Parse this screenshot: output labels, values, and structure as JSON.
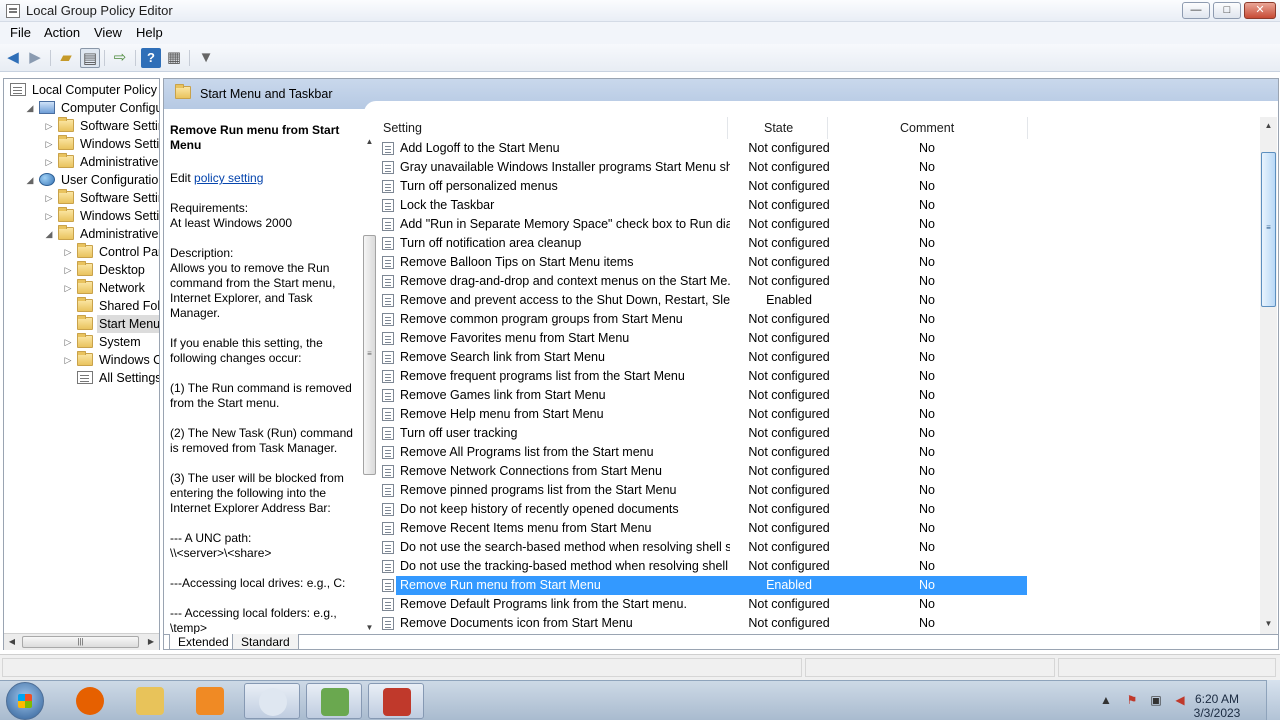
{
  "window": {
    "title": "Local Group Policy Editor",
    "min": "—",
    "max": "□",
    "close": "✕"
  },
  "menu": [
    "File",
    "Action",
    "View",
    "Help"
  ],
  "toolbar": [
    "back-icon",
    "forward-icon",
    "up-folder-icon",
    "show-hide-tree-icon",
    "export-list-icon",
    "help-icon",
    "properties-icon",
    "filter-icon"
  ],
  "tree": [
    {
      "label": "Local Computer Policy",
      "level": 0,
      "icon": "policy-doc-icon",
      "expander": ""
    },
    {
      "label": "Computer Configura",
      "level": 1,
      "icon": "computer-icon",
      "expander": "◢"
    },
    {
      "label": "Software Settings",
      "level": 2,
      "icon": "folder-icon",
      "expander": "▷"
    },
    {
      "label": "Windows Setting",
      "level": 2,
      "icon": "folder-icon",
      "expander": "▷"
    },
    {
      "label": "Administrative Te",
      "level": 2,
      "icon": "folder-icon",
      "expander": "▷"
    },
    {
      "label": "User Configuration",
      "level": 1,
      "icon": "users-icon",
      "expander": "◢"
    },
    {
      "label": "Software Settings",
      "level": 2,
      "icon": "folder-icon",
      "expander": "▷"
    },
    {
      "label": "Windows Setting",
      "level": 2,
      "icon": "folder-icon",
      "expander": "▷"
    },
    {
      "label": "Administrative Te",
      "level": 2,
      "icon": "folder-icon",
      "expander": "◢"
    },
    {
      "label": "Control Panel",
      "level": 3,
      "icon": "folder-icon",
      "expander": "▷"
    },
    {
      "label": "Desktop",
      "level": 3,
      "icon": "folder-icon",
      "expander": "▷"
    },
    {
      "label": "Network",
      "level": 3,
      "icon": "folder-icon",
      "expander": "▷"
    },
    {
      "label": "Shared Folder",
      "level": 3,
      "icon": "folder-icon",
      "expander": ""
    },
    {
      "label": "Start Menu ar",
      "level": 3,
      "icon": "folder-icon",
      "expander": "",
      "selected": true
    },
    {
      "label": "System",
      "level": 3,
      "icon": "folder-icon",
      "expander": "▷"
    },
    {
      "label": "Windows Cor",
      "level": 3,
      "icon": "folder-icon",
      "expander": "▷"
    },
    {
      "label": "All Settings",
      "level": 3,
      "icon": "all-settings-icon",
      "expander": ""
    }
  ],
  "pane": {
    "header": "Start Menu and Taskbar"
  },
  "description": {
    "title": "Remove Run menu from Start Menu",
    "edit_prefix": "Edit ",
    "edit_link": "policy setting",
    "paragraphs": [
      "Requirements:\nAt least Windows 2000",
      "Description:\nAllows you to remove the Run command from the Start menu, Internet Explorer, and Task Manager.",
      "If you enable this setting, the following changes occur:",
      "(1) The Run command is removed from the Start menu.",
      "(2) The New Task (Run) command is removed from Task Manager.",
      "(3) The user will be blocked from entering the following into the Internet Explorer Address Bar:",
      "--- A UNC path:\n\\\\<server>\\<share>",
      "---Accessing local drives:  e.g., C:",
      "--- Accessing local folders: e.g.,\n\\temp>"
    ]
  },
  "columns": {
    "setting": "Setting",
    "state": "State",
    "comment": "Comment"
  },
  "rows": [
    {
      "setting": "Add Logoff to the Start Menu",
      "state": "Not configured",
      "comment": "No"
    },
    {
      "setting": "Gray unavailable Windows Installer programs Start Menu sh...",
      "state": "Not configured",
      "comment": "No"
    },
    {
      "setting": "Turn off personalized menus",
      "state": "Not configured",
      "comment": "No"
    },
    {
      "setting": "Lock the Taskbar",
      "state": "Not configured",
      "comment": "No"
    },
    {
      "setting": "Add \"Run in Separate Memory Space\" check box to Run dial...",
      "state": "Not configured",
      "comment": "No"
    },
    {
      "setting": "Turn off notification area cleanup",
      "state": "Not configured",
      "comment": "No"
    },
    {
      "setting": "Remove Balloon Tips on Start Menu items",
      "state": "Not configured",
      "comment": "No"
    },
    {
      "setting": "Remove drag-and-drop and context menus on the Start Me...",
      "state": "Not configured",
      "comment": "No"
    },
    {
      "setting": "Remove and prevent access to the Shut Down, Restart, Sleep...",
      "state": "Enabled",
      "comment": "No"
    },
    {
      "setting": "Remove common program groups from Start Menu",
      "state": "Not configured",
      "comment": "No"
    },
    {
      "setting": "Remove Favorites menu from Start Menu",
      "state": "Not configured",
      "comment": "No"
    },
    {
      "setting": "Remove Search link from Start Menu",
      "state": "Not configured",
      "comment": "No"
    },
    {
      "setting": "Remove frequent programs list from the Start Menu",
      "state": "Not configured",
      "comment": "No"
    },
    {
      "setting": "Remove Games link from Start Menu",
      "state": "Not configured",
      "comment": "No"
    },
    {
      "setting": "Remove Help menu from Start Menu",
      "state": "Not configured",
      "comment": "No"
    },
    {
      "setting": "Turn off user tracking",
      "state": "Not configured",
      "comment": "No"
    },
    {
      "setting": "Remove All Programs list from the Start menu",
      "state": "Not configured",
      "comment": "No"
    },
    {
      "setting": "Remove Network Connections from Start Menu",
      "state": "Not configured",
      "comment": "No"
    },
    {
      "setting": "Remove pinned programs list from the Start Menu",
      "state": "Not configured",
      "comment": "No"
    },
    {
      "setting": "Do not keep history of recently opened documents",
      "state": "Not configured",
      "comment": "No"
    },
    {
      "setting": "Remove Recent Items menu from Start Menu",
      "state": "Not configured",
      "comment": "No"
    },
    {
      "setting": "Do not use the search-based method when resolving shell s...",
      "state": "Not configured",
      "comment": "No"
    },
    {
      "setting": "Do not use the tracking-based method when resolving shell ...",
      "state": "Not configured",
      "comment": "No"
    },
    {
      "setting": "Remove Run menu from Start Menu",
      "state": "Enabled",
      "comment": "No",
      "selected": true
    },
    {
      "setting": "Remove Default Programs link from the Start menu.",
      "state": "Not configured",
      "comment": "No"
    },
    {
      "setting": "Remove Documents icon from Start Menu",
      "state": "Not configured",
      "comment": "No"
    }
  ],
  "tabs": [
    "Extended",
    "Standard"
  ],
  "taskbar": {
    "items": [
      {
        "name": "firefox-icon",
        "color": "#e66000"
      },
      {
        "name": "file-explorer-icon",
        "color": "#e8c35a"
      },
      {
        "name": "media-player-icon",
        "color": "#f08a24"
      },
      {
        "name": "blank-app-icon",
        "color": "#dfe7f1",
        "active": true
      },
      {
        "name": "network-users-icon",
        "color": "#6aa84f",
        "active": true
      },
      {
        "name": "toolbox-icon",
        "color": "#c0392b",
        "active": true
      }
    ],
    "time": "6:20 AM",
    "date": "3/3/2023"
  },
  "colors": {
    "selection": "#3399ff",
    "header": "#b6c9e3"
  }
}
